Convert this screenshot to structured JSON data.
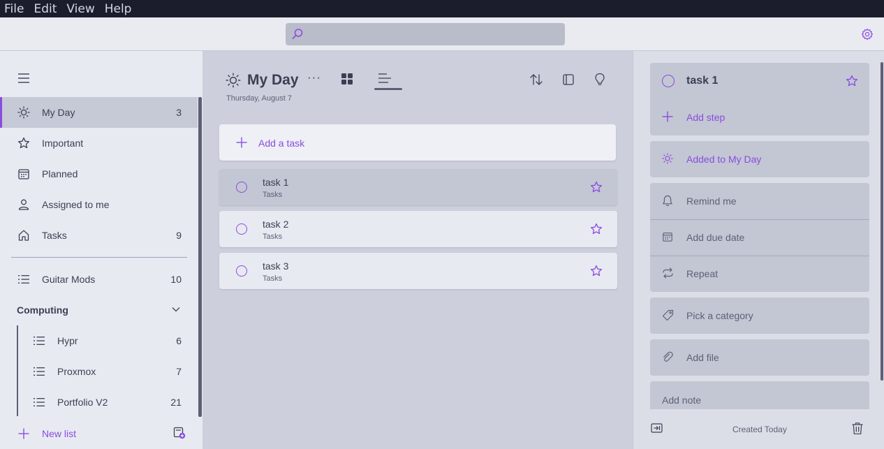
{
  "menubar": {
    "items": [
      "File",
      "Edit",
      "View",
      "Help"
    ]
  },
  "header": {
    "search_placeholder": "",
    "search_icon": "search-icon",
    "settings_icon": "gear-icon"
  },
  "colors": {
    "accent": "#8a4cdf",
    "text": "#3b3f52",
    "muted": "#5d6075",
    "sidebar_bg": "#e8eaf1",
    "main_bg": "#cdd0dc",
    "detail_bg": "#dcdee7"
  },
  "sidebar": {
    "items": [
      {
        "label": "My Day",
        "count": "3",
        "icon": "sun-icon",
        "active": true
      },
      {
        "label": "Important",
        "count": "",
        "icon": "star-icon"
      },
      {
        "label": "Planned",
        "count": "",
        "icon": "calendar-icon"
      },
      {
        "label": "Assigned to me",
        "count": "",
        "icon": "person-icon"
      },
      {
        "label": "Tasks",
        "count": "9",
        "icon": "home-icon"
      }
    ],
    "lists": [
      {
        "label": "Guitar Mods",
        "count": "10",
        "icon": "list-icon"
      }
    ],
    "group": {
      "label": "Computing",
      "expanded": true,
      "items": [
        {
          "label": "Hypr",
          "count": "6"
        },
        {
          "label": "Proxmox",
          "count": "7"
        },
        {
          "label": "Portfolio V2",
          "count": "21"
        }
      ]
    },
    "new_list_label": "New list"
  },
  "main": {
    "title": "My Day",
    "more": "···",
    "date": "Thursday, August 7",
    "add_task_label": "Add a task",
    "view_mode": "list",
    "tasks": [
      {
        "name": "task 1",
        "list": "Tasks",
        "selected": true
      },
      {
        "name": "task 2",
        "list": "Tasks"
      },
      {
        "name": "task 3",
        "list": "Tasks"
      }
    ]
  },
  "detail": {
    "task_name": "task 1",
    "add_step": "Add step",
    "my_day": "Added to My Day",
    "remind": "Remind me",
    "due": "Add due date",
    "repeat": "Repeat",
    "category": "Pick a category",
    "file": "Add file",
    "note_placeholder": "Add note",
    "created": "Created Today"
  }
}
